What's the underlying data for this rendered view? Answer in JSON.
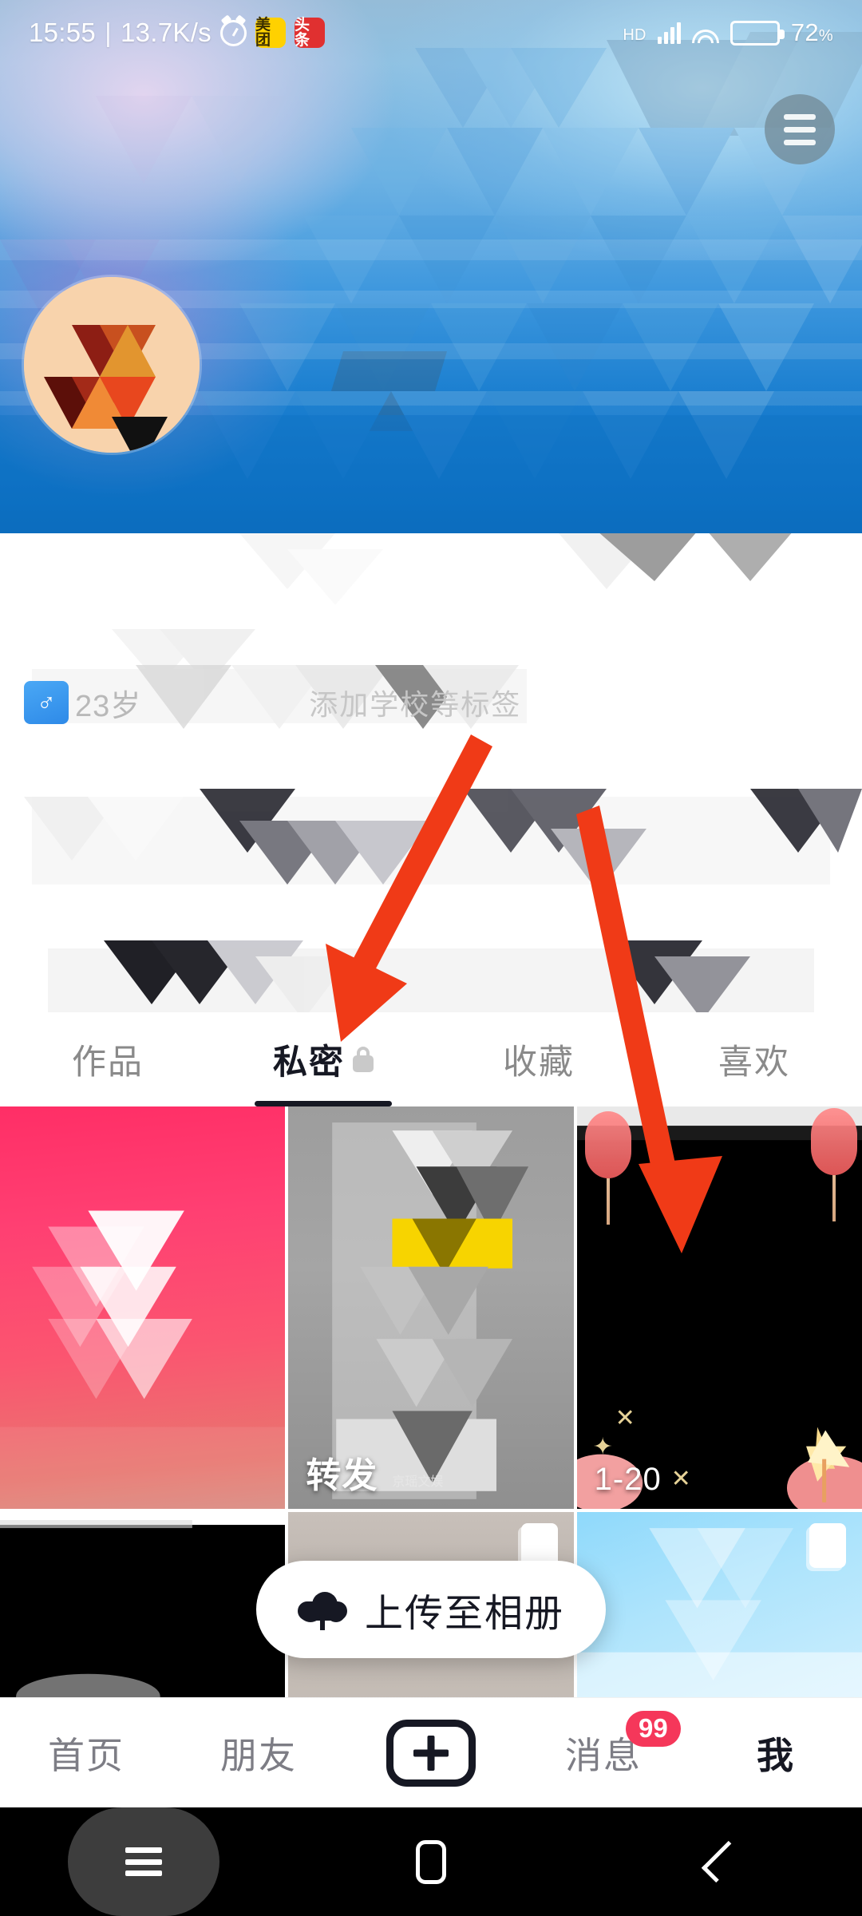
{
  "status_bar": {
    "time": "15:55",
    "separator": "|",
    "network_speed": "13.7K/s",
    "alarm_icon": "alarm-clock-icon",
    "app_icons": [
      {
        "name": "meituan-icon",
        "label": "美团",
        "color": "#ffd100"
      },
      {
        "name": "toutiao-icon",
        "label": "头条",
        "color": "#e03030"
      }
    ],
    "hd_label": "HD",
    "signal_icon": "cellular-signal-icon",
    "wifi_icon": "wifi-icon",
    "battery_icon": "battery-icon",
    "battery_level": "72",
    "battery_unit": "%",
    "battery_fill_color": "#f5a623"
  },
  "header": {
    "menu_icon": "hamburger-menu-icon",
    "avatar_name": "profile-avatar"
  },
  "profile": {
    "gender_symbol": "♂",
    "age_text": "23岁",
    "tag_text": "添加学校等标签",
    "gender_chip_color": "#2e8ae8"
  },
  "tabs": {
    "items": [
      {
        "label": "作品",
        "active": false,
        "locked": false
      },
      {
        "label": "私密",
        "active": true,
        "locked": true
      },
      {
        "label": "收藏",
        "active": false,
        "locked": false
      },
      {
        "label": "喜欢",
        "active": false,
        "locked": false
      }
    ],
    "active_underline_color": "#161823",
    "lock_icon": "lock-icon"
  },
  "grid": {
    "items": [
      {
        "name": "thumbnail-1",
        "caption": "",
        "subcaption": ""
      },
      {
        "name": "thumbnail-2",
        "caption": "转发",
        "subcaption": "京瑶文娱"
      },
      {
        "name": "thumbnail-3",
        "caption": "1-20",
        "subcaption": ""
      },
      {
        "name": "thumbnail-4",
        "caption": "",
        "subcaption": ""
      },
      {
        "name": "thumbnail-5",
        "caption": "",
        "subcaption": ""
      },
      {
        "name": "thumbnail-6",
        "caption": "",
        "subcaption": ""
      }
    ]
  },
  "upload_button": {
    "label": "上传至相册",
    "icon": "cloud-upload-icon"
  },
  "bottom_nav": {
    "items": [
      {
        "label": "首页",
        "active": false
      },
      {
        "label": "朋友",
        "active": false
      },
      {
        "label": "",
        "active": false,
        "icon": "plus-create-icon"
      },
      {
        "label": "消息",
        "active": false,
        "badge": "99"
      },
      {
        "label": "我",
        "active": true
      }
    ],
    "badge_color": "#f5375a"
  },
  "android_nav": {
    "recents_icon": "recents-icon",
    "home_icon": "home-icon",
    "back_icon": "back-icon"
  },
  "annotations": {
    "arrow_color": "#f03a17",
    "arrow_1_target": "私密",
    "arrow_2_target": "thumbnail-3"
  }
}
